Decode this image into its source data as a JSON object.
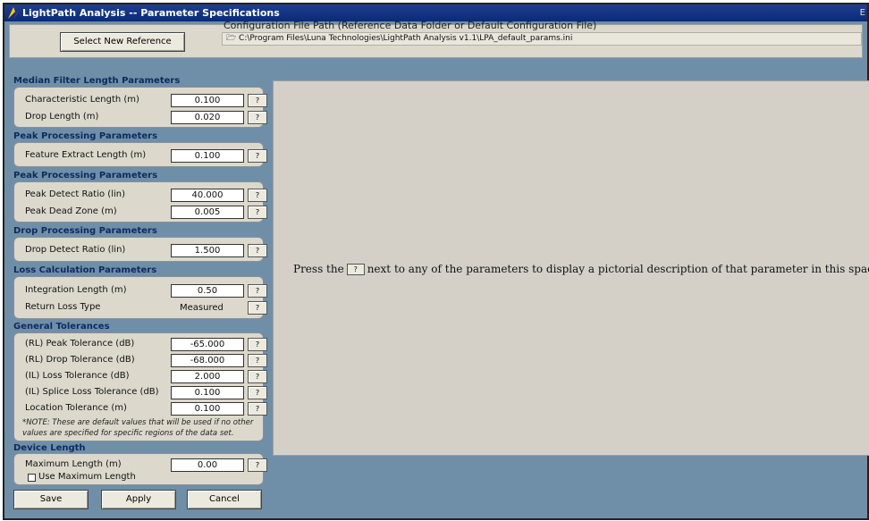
{
  "window": {
    "title": "LightPath Analysis -- Parameter Specifications",
    "corner_glyph": "E"
  },
  "topbar": {
    "select_button": "Select New Reference",
    "config_label": "Configuration File Path (Reference Data Folder or Default Configuration File)",
    "config_path": "C:\\Program Files\\Luna Technologies\\LightPath Analysis v1.1\\LPA_default_params.ini"
  },
  "help_button_label": "?",
  "sections": {
    "median": {
      "header": "Median Filter Length Parameters",
      "rows": [
        {
          "label": "Characteristic Length (m)",
          "value": "0.100"
        },
        {
          "label": "Drop Length (m)",
          "value": "0.020"
        }
      ]
    },
    "peak1": {
      "header": "Peak Processing Parameters",
      "rows": [
        {
          "label": "Feature Extract Length (m)",
          "value": "0.100"
        }
      ]
    },
    "peak2": {
      "header": "Peak Processing Parameters",
      "rows": [
        {
          "label": "Peak Detect Ratio (lin)",
          "value": "40.000"
        },
        {
          "label": "Peak Dead Zone (m)",
          "value": "0.005"
        }
      ]
    },
    "drop": {
      "header": "Drop Processing Parameters",
      "rows": [
        {
          "label": "Drop Detect Ratio (lin)",
          "value": "1.500"
        }
      ]
    },
    "loss": {
      "header": "Loss Calculation Parameters",
      "rows": [
        {
          "label": "Integration Length (m)",
          "value": "0.50"
        },
        {
          "label": "Return Loss Type",
          "value": "Measured"
        }
      ]
    },
    "tolerances": {
      "header": "General Tolerances",
      "rows": [
        {
          "label": "(RL)  Peak Tolerance (dB)",
          "value": "-65.000"
        },
        {
          "label": "(RL)  Drop Tolerance (dB)",
          "value": "-68.000"
        },
        {
          "label": "(IL)  Loss Tolerance (dB)",
          "value": "2.000"
        },
        {
          "label": "(IL)  Splice Loss Tolerance (dB)",
          "value": "0.100"
        },
        {
          "label": "Location Tolerance (m)",
          "value": "0.100"
        }
      ],
      "note": "*NOTE:  These are default values that will be used if no other values are specified for specific regions of the data set."
    },
    "device": {
      "header": "Device Length",
      "rows": [
        {
          "label": "Maximum Length (m)",
          "value": "0.00"
        }
      ],
      "checkbox_label": "Use Maximum Length",
      "checkbox_checked": false
    }
  },
  "footer": {
    "save": "Save",
    "apply": "Apply",
    "cancel": "Cancel"
  },
  "display": {
    "text_before": "Press the",
    "text_after": "next to any of the parameters to display a pictorial description of that parameter in this space."
  }
}
